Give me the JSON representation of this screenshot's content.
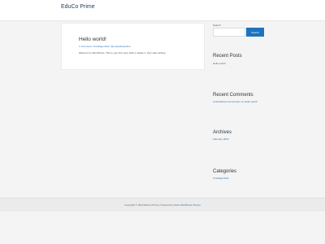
{
  "header": {
    "site_title": "EduCo Prime"
  },
  "post": {
    "title": "Hello world!",
    "meta": "1 Comment / Uncategorized / By wpadminprime",
    "excerpt": "Welcome to WordPress. This is your first post. Edit or delete it, then start writing!"
  },
  "sidebar": {
    "search": {
      "label": "Search",
      "placeholder": "",
      "button_label": "Search"
    },
    "recent_posts": {
      "title": "Recent Posts",
      "items": [
        "Hello world!"
      ]
    },
    "recent_comments": {
      "title": "Recent Comments",
      "items": [
        "A WordPress Commenter on Hello world!"
      ]
    },
    "archives": {
      "title": "Archives",
      "items": [
        "February 2022"
      ]
    },
    "categories": {
      "title": "Categories",
      "items": [
        "Uncategorized"
      ]
    }
  },
  "footer": {
    "copyright": "Copyright © 2022 EduCo Prime | Powered by ",
    "theme_link": "Astra WordPress Theme"
  },
  "colors": {
    "accent": "#1e73be",
    "link": "#2a6fb0",
    "background": "#f4f4f4"
  }
}
